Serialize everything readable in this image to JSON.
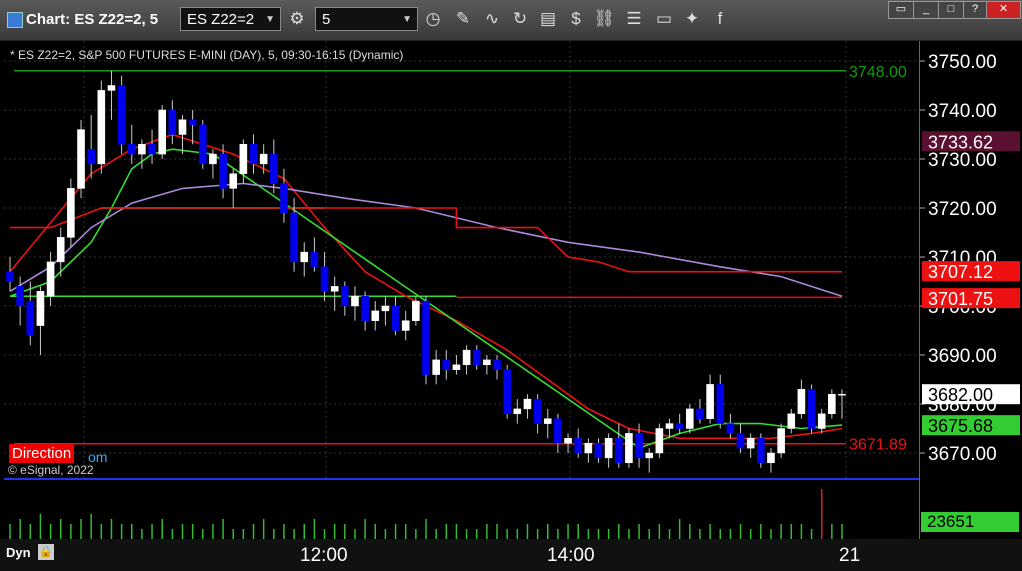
{
  "window": {
    "title": "Chart: ES Z22=2, 5"
  },
  "toolbar": {
    "symbol_value": "ES Z22=2",
    "interval_value": "5",
    "icons": [
      "settings-gear-icon",
      "clock-icon",
      "pencil-icon",
      "compare-icon",
      "refresh-icon",
      "news-icon",
      "dollar-icon",
      "link-icon",
      "list-icon",
      "chat-icon",
      "twitter-icon",
      "facebook-icon"
    ]
  },
  "chart": {
    "legend": "* ES Z22=2, S&P 500 FUTURES E-MINI (DAY), 5, 09:30-16:15 (Dynamic)",
    "copyright": "© eSignal, 2022",
    "direction_label": "Direction",
    "direction_link": "om",
    "dyn_label": "Dyn",
    "volume_value": "23651"
  },
  "chart_data": {
    "type": "candlestick",
    "ylim": [
      3664,
      3752
    ],
    "y_ticks": [
      3670,
      3680,
      3690,
      3700,
      3710,
      3720,
      3730,
      3740,
      3750
    ],
    "x_ticks": [
      "12:00",
      "14:00",
      "21"
    ],
    "grid": true,
    "colors": {
      "up": "#ffffff",
      "down": "#0000ee",
      "wick": "#cccccc",
      "grid": "#333333"
    },
    "price_labels": [
      {
        "value": "3733.62",
        "bg": "#5a1030",
        "fg": "#ffffff"
      },
      {
        "value": "3707.12",
        "bg": "#ee1111",
        "fg": "#ffffff"
      },
      {
        "value": "3701.75",
        "bg": "#ee1111",
        "fg": "#ffffff"
      },
      {
        "value": "3682.00",
        "bg": "#ffffff",
        "fg": "#000000"
      },
      {
        "value": "3675.68",
        "bg": "#33cc33",
        "fg": "#000000"
      }
    ],
    "horizontal_lines": [
      {
        "value": 3748.0,
        "label": "3748.00",
        "color": "#119911"
      },
      {
        "value": 3671.89,
        "label": "3671.89",
        "color": "#ee1111"
      }
    ],
    "candles": [
      {
        "o": 3707,
        "h": 3710,
        "l": 3703,
        "c": 3705
      },
      {
        "o": 3704,
        "h": 3706,
        "l": 3696,
        "c": 3700
      },
      {
        "o": 3701,
        "h": 3705,
        "l": 3692,
        "c": 3694
      },
      {
        "o": 3696,
        "h": 3704,
        "l": 3690,
        "c": 3703
      },
      {
        "o": 3702,
        "h": 3711,
        "l": 3700,
        "c": 3709
      },
      {
        "o": 3709,
        "h": 3716,
        "l": 3706,
        "c": 3714
      },
      {
        "o": 3714,
        "h": 3726,
        "l": 3712,
        "c": 3724
      },
      {
        "o": 3724,
        "h": 3738,
        "l": 3722,
        "c": 3736
      },
      {
        "o": 3732,
        "h": 3739,
        "l": 3726,
        "c": 3729
      },
      {
        "o": 3729,
        "h": 3746,
        "l": 3727,
        "c": 3744
      },
      {
        "o": 3744,
        "h": 3748,
        "l": 3738,
        "c": 3745
      },
      {
        "o": 3745,
        "h": 3747,
        "l": 3731,
        "c": 3733
      },
      {
        "o": 3733,
        "h": 3737,
        "l": 3729,
        "c": 3731
      },
      {
        "o": 3731,
        "h": 3734,
        "l": 3728,
        "c": 3733
      },
      {
        "o": 3733,
        "h": 3736,
        "l": 3729,
        "c": 3731
      },
      {
        "o": 3731,
        "h": 3741,
        "l": 3730,
        "c": 3740
      },
      {
        "o": 3740,
        "h": 3742,
        "l": 3733,
        "c": 3735
      },
      {
        "o": 3735,
        "h": 3739,
        "l": 3731,
        "c": 3738
      },
      {
        "o": 3738,
        "h": 3740,
        "l": 3733,
        "c": 3737
      },
      {
        "o": 3737,
        "h": 3738,
        "l": 3728,
        "c": 3729
      },
      {
        "o": 3729,
        "h": 3732,
        "l": 3726,
        "c": 3731
      },
      {
        "o": 3731,
        "h": 3733,
        "l": 3722,
        "c": 3724
      },
      {
        "o": 3724,
        "h": 3728,
        "l": 3720,
        "c": 3727
      },
      {
        "o": 3727,
        "h": 3734,
        "l": 3725,
        "c": 3733
      },
      {
        "o": 3733,
        "h": 3735,
        "l": 3727,
        "c": 3729
      },
      {
        "o": 3729,
        "h": 3733,
        "l": 3727,
        "c": 3731
      },
      {
        "o": 3731,
        "h": 3734,
        "l": 3723,
        "c": 3725
      },
      {
        "o": 3725,
        "h": 3728,
        "l": 3717,
        "c": 3719
      },
      {
        "o": 3719,
        "h": 3722,
        "l": 3707,
        "c": 3709
      },
      {
        "o": 3709,
        "h": 3713,
        "l": 3706,
        "c": 3711
      },
      {
        "o": 3711,
        "h": 3714,
        "l": 3707,
        "c": 3708
      },
      {
        "o": 3708,
        "h": 3711,
        "l": 3701,
        "c": 3703
      },
      {
        "o": 3703,
        "h": 3706,
        "l": 3699,
        "c": 3704
      },
      {
        "o": 3704,
        "h": 3705,
        "l": 3698,
        "c": 3700
      },
      {
        "o": 3700,
        "h": 3704,
        "l": 3697,
        "c": 3702
      },
      {
        "o": 3702,
        "h": 3703,
        "l": 3695,
        "c": 3697
      },
      {
        "o": 3697,
        "h": 3701,
        "l": 3695,
        "c": 3699
      },
      {
        "o": 3699,
        "h": 3702,
        "l": 3696,
        "c": 3700
      },
      {
        "o": 3700,
        "h": 3702,
        "l": 3694,
        "c": 3695
      },
      {
        "o": 3695,
        "h": 3699,
        "l": 3693,
        "c": 3697
      },
      {
        "o": 3697,
        "h": 3702,
        "l": 3696,
        "c": 3701
      },
      {
        "o": 3701,
        "h": 3702,
        "l": 3684,
        "c": 3686
      },
      {
        "o": 3686,
        "h": 3691,
        "l": 3684,
        "c": 3689
      },
      {
        "o": 3689,
        "h": 3691,
        "l": 3685,
        "c": 3687
      },
      {
        "o": 3687,
        "h": 3690,
        "l": 3686,
        "c": 3688
      },
      {
        "o": 3688,
        "h": 3692,
        "l": 3686,
        "c": 3691
      },
      {
        "o": 3691,
        "h": 3692,
        "l": 3687,
        "c": 3688
      },
      {
        "o": 3688,
        "h": 3690,
        "l": 3686,
        "c": 3689
      },
      {
        "o": 3689,
        "h": 3690,
        "l": 3685,
        "c": 3687
      },
      {
        "o": 3687,
        "h": 3688,
        "l": 3677,
        "c": 3678
      },
      {
        "o": 3678,
        "h": 3681,
        "l": 3676,
        "c": 3679
      },
      {
        "o": 3679,
        "h": 3682,
        "l": 3677,
        "c": 3681
      },
      {
        "o": 3681,
        "h": 3682,
        "l": 3674,
        "c": 3676
      },
      {
        "o": 3676,
        "h": 3679,
        "l": 3673,
        "c": 3677
      },
      {
        "o": 3677,
        "h": 3678,
        "l": 3670,
        "c": 3672
      },
      {
        "o": 3672,
        "h": 3674,
        "l": 3670,
        "c": 3673
      },
      {
        "o": 3673,
        "h": 3675,
        "l": 3669,
        "c": 3670
      },
      {
        "o": 3670,
        "h": 3673,
        "l": 3668,
        "c": 3672
      },
      {
        "o": 3672,
        "h": 3673,
        "l": 3668,
        "c": 3669
      },
      {
        "o": 3669,
        "h": 3674,
        "l": 3667,
        "c": 3673
      },
      {
        "o": 3673,
        "h": 3676,
        "l": 3667,
        "c": 3668
      },
      {
        "o": 3668,
        "h": 3675,
        "l": 3667,
        "c": 3674
      },
      {
        "o": 3674,
        "h": 3676,
        "l": 3667,
        "c": 3669
      },
      {
        "o": 3669,
        "h": 3671,
        "l": 3666,
        "c": 3670
      },
      {
        "o": 3670,
        "h": 3676,
        "l": 3669,
        "c": 3675
      },
      {
        "o": 3675,
        "h": 3677,
        "l": 3673,
        "c": 3676
      },
      {
        "o": 3676,
        "h": 3678,
        "l": 3674,
        "c": 3675
      },
      {
        "o": 3675,
        "h": 3680,
        "l": 3674,
        "c": 3679
      },
      {
        "o": 3679,
        "h": 3681,
        "l": 3676,
        "c": 3677
      },
      {
        "o": 3677,
        "h": 3686,
        "l": 3676,
        "c": 3684
      },
      {
        "o": 3684,
        "h": 3686,
        "l": 3675,
        "c": 3676
      },
      {
        "o": 3676,
        "h": 3678,
        "l": 3673,
        "c": 3674
      },
      {
        "o": 3674,
        "h": 3676,
        "l": 3670,
        "c": 3671
      },
      {
        "o": 3671,
        "h": 3674,
        "l": 3669,
        "c": 3673
      },
      {
        "o": 3673,
        "h": 3674,
        "l": 3667,
        "c": 3668
      },
      {
        "o": 3668,
        "h": 3671,
        "l": 3666,
        "c": 3670
      },
      {
        "o": 3670,
        "h": 3676,
        "l": 3669,
        "c": 3675
      },
      {
        "o": 3675,
        "h": 3679,
        "l": 3674,
        "c": 3678
      },
      {
        "o": 3678,
        "h": 3685,
        "l": 3677,
        "c": 3683
      },
      {
        "o": 3683,
        "h": 3684,
        "l": 3674,
        "c": 3675
      },
      {
        "o": 3675,
        "h": 3679,
        "l": 3674,
        "c": 3678
      },
      {
        "o": 3678,
        "h": 3683,
        "l": 3677,
        "c": 3682
      },
      {
        "o": 3682,
        "h": 3683,
        "l": 3677,
        "c": 3682
      }
    ],
    "series": [
      {
        "color": "#ee1111",
        "values": [
          [
            0,
            3707
          ],
          [
            8,
            3727
          ],
          [
            12,
            3732
          ],
          [
            16,
            3735
          ],
          [
            22,
            3731
          ],
          [
            27,
            3726
          ],
          [
            31,
            3716
          ],
          [
            35,
            3707
          ],
          [
            39,
            3702
          ],
          [
            44,
            3697
          ],
          [
            49,
            3691
          ],
          [
            53,
            3685
          ],
          [
            57,
            3679
          ],
          [
            61,
            3675
          ],
          [
            66,
            3673
          ],
          [
            70,
            3673
          ],
          [
            75,
            3673
          ],
          [
            79,
            3674
          ],
          [
            82,
            3675
          ]
        ]
      },
      {
        "color": "#33dd33",
        "values": [
          [
            0,
            3702
          ],
          [
            4,
            3705
          ],
          [
            8,
            3713
          ],
          [
            10,
            3720
          ],
          [
            12,
            3728
          ],
          [
            14,
            3731
          ],
          [
            16,
            3732
          ],
          [
            20,
            3731
          ],
          [
            62,
            3671
          ],
          [
            66,
            3674
          ],
          [
            70,
            3676
          ],
          [
            74,
            3676
          ],
          [
            78,
            3675
          ],
          [
            82,
            3675.7
          ]
        ]
      },
      {
        "color": "#a989d9",
        "values": [
          [
            0,
            3703
          ],
          [
            4,
            3708
          ],
          [
            8,
            3716
          ],
          [
            12,
            3721
          ],
          [
            17,
            3724
          ],
          [
            23,
            3725
          ],
          [
            27,
            3724
          ],
          [
            33,
            3722
          ],
          [
            40,
            3720
          ],
          [
            48,
            3716
          ],
          [
            55,
            3713
          ],
          [
            62,
            3711
          ],
          [
            70,
            3708
          ],
          [
            76,
            3706
          ],
          [
            82,
            3702
          ]
        ]
      },
      {
        "color": "#ee1111",
        "step": true,
        "values": [
          [
            0,
            3716
          ],
          [
            4,
            3716
          ],
          [
            9,
            3720
          ],
          [
            44,
            3720
          ],
          [
            44,
            3716
          ],
          [
            52,
            3716
          ],
          [
            55,
            3710
          ],
          [
            58,
            3709
          ],
          [
            61,
            3707
          ],
          [
            82,
            3707
          ]
        ]
      }
    ],
    "horizontal_segments": [
      {
        "color": "#33dd33",
        "value": 3720,
        "from": 9,
        "to": 31
      },
      {
        "color": "#33dd33",
        "value": 3702,
        "from": 0,
        "to": 44
      },
      {
        "color": "#ee1111",
        "value": 3701.75,
        "from": 44,
        "to": 82
      }
    ],
    "volume": [
      3,
      4,
      3,
      5,
      3,
      4,
      3,
      4,
      5,
      3,
      4,
      3,
      3,
      2,
      3,
      4,
      2,
      3,
      3,
      2,
      3,
      4,
      2,
      2,
      3,
      4,
      2,
      3,
      2,
      3,
      4,
      2,
      3,
      3,
      2,
      4,
      3,
      2,
      3,
      3,
      2,
      4,
      2,
      3,
      3,
      2,
      2,
      3,
      3,
      2,
      2,
      3,
      2,
      3,
      2,
      3,
      3,
      2,
      2,
      2,
      3,
      2,
      3,
      2,
      3,
      2,
      4,
      3,
      2,
      3,
      2,
      2,
      3,
      2,
      3,
      2,
      3,
      3,
      3,
      2,
      10,
      3,
      3
    ]
  }
}
